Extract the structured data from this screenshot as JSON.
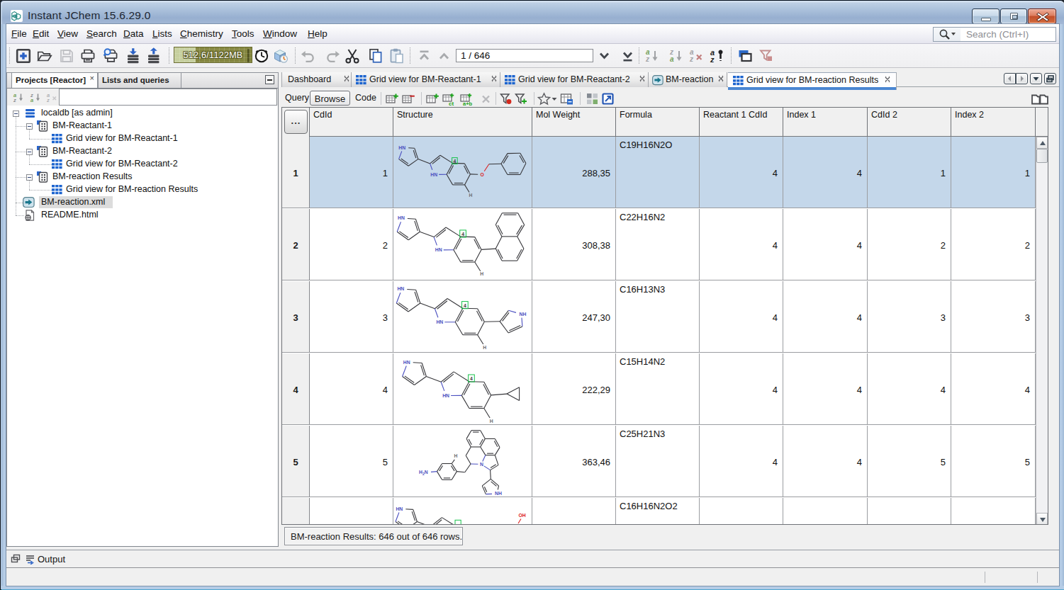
{
  "window": {
    "title": "Instant JChem 15.6.29.0",
    "controls": {
      "minimize": "minimize",
      "maximize": "maximize",
      "close": "close"
    }
  },
  "menu": {
    "items": [
      {
        "label": "File"
      },
      {
        "label": "Edit"
      },
      {
        "label": "View"
      },
      {
        "label": "Search"
      },
      {
        "label": "Data"
      },
      {
        "label": "Lists"
      },
      {
        "label": "Chemistry"
      },
      {
        "label": "Tools"
      },
      {
        "label": "Window"
      },
      {
        "label": "Help"
      }
    ]
  },
  "toolbar": {
    "memory": "512,6/1122MB",
    "record_position": "1 / 646",
    "icons": [
      "new-form-icon",
      "open-project-icon",
      "save-icon",
      "print-icon",
      "print-preview-icon",
      "import-icon",
      "export-icon",
      "garbage-collect-clock-icon",
      "scheduler-cube-icon",
      "undo-icon",
      "redo-icon",
      "cut-icon",
      "copy-icon",
      "paste-icon",
      "first-record-icon",
      "previous-record-icon",
      "next-record-icon",
      "last-record-icon",
      "sort-ascending-icon",
      "sort-descending-icon",
      "clear-sort-icon",
      "sort-options-icon",
      "windows-icon",
      "filter-icon"
    ]
  },
  "search": {
    "placeholder": "Search (Ctrl+I)"
  },
  "left_panel": {
    "tabs": [
      {
        "label": "Projects [Reactor]",
        "active": true,
        "closable": true
      },
      {
        "label": "Lists and queries",
        "active": false
      }
    ],
    "filter_value": "",
    "tree": [
      {
        "label": "localdb [as admin]",
        "icon": "database-icon",
        "level": 0,
        "expanded": true
      },
      {
        "label": "BM-Reactant-1",
        "icon": "data-tree-icon",
        "level": 1,
        "expanded": true
      },
      {
        "label": "Grid view for BM-Reactant-1",
        "icon": "grid-view-icon",
        "level": 2
      },
      {
        "label": "BM-Reactant-2",
        "icon": "data-tree-icon",
        "level": 1,
        "expanded": true
      },
      {
        "label": "Grid view for BM-Reactant-2",
        "icon": "grid-view-icon",
        "level": 2
      },
      {
        "label": "BM-reaction Results",
        "icon": "data-tree-icon",
        "level": 1,
        "expanded": true
      },
      {
        "label": "Grid view for BM-reaction Results",
        "icon": "grid-view-icon",
        "level": 2
      },
      {
        "label": "BM-reaction.xml",
        "icon": "reaction-file-icon",
        "level": 0,
        "selected": true
      },
      {
        "label": "README.html",
        "icon": "html-file-icon",
        "level": 0
      }
    ]
  },
  "main_tabs": [
    {
      "label": "Dashboard",
      "icon": null,
      "active": false
    },
    {
      "label": "Grid view for BM-Reactant-1",
      "icon": "grid-view-icon",
      "active": false
    },
    {
      "label": "Grid view for BM-Reactant-2",
      "icon": "grid-view-icon",
      "active": false
    },
    {
      "label": "BM-reaction",
      "icon": "reaction-file-icon",
      "active": false
    },
    {
      "label": "Grid view for BM-reaction Results",
      "icon": "grid-view-icon",
      "active": true
    }
  ],
  "view_toolbar": {
    "modes": [
      {
        "label": "Query"
      },
      {
        "label": "Browse",
        "active": true
      },
      {
        "label": "Code"
      }
    ],
    "icons": [
      "add-row-icon",
      "delete-row-icon",
      "add-field-icon",
      "add-chemical-terms-field-icon",
      "add-calculated-field-icon",
      "remove-field-icon",
      "filter-red-icon",
      "add-filter-icon",
      "favorites-star-icon",
      "favorites-dropdown-icon",
      "grid-settings-icon",
      "layout-grid-icon",
      "open-in-new-icon",
      "book-icon"
    ]
  },
  "grid": {
    "corner_button": "...",
    "columns": [
      "CdId",
      "Structure",
      "Mol Weight",
      "Formula",
      "Reactant 1 CdId",
      "Index 1",
      "CdId 2",
      "Index 2"
    ],
    "rows": [
      {
        "row_num": "1",
        "cdid": "1",
        "mol_weight": "288,35",
        "formula": "C19H16N2O",
        "reactant1_cdid": "4",
        "index1": "4",
        "cdid2": "1",
        "index2": "1",
        "selected": true,
        "structure": "5-(benzyloxy)-2-(1H-pyrrol-3-yl)-1H-indole"
      },
      {
        "row_num": "2",
        "cdid": "2",
        "mol_weight": "308,38",
        "formula": "C22H16N2",
        "reactant1_cdid": "4",
        "index1": "4",
        "cdid2": "2",
        "index2": "2",
        "selected": false,
        "structure": "5-(naphthalen-1-yl)-2-(1H-pyrrol-3-yl)-1H-indole"
      },
      {
        "row_num": "3",
        "cdid": "3",
        "mol_weight": "247,30",
        "formula": "C16H13N3",
        "reactant1_cdid": "4",
        "index1": "4",
        "cdid2": "3",
        "index2": "3",
        "selected": false,
        "structure": "5-(1H-pyrrol-3-yl)-2-(1H-pyrrol-3-yl)-1H-indole"
      },
      {
        "row_num": "4",
        "cdid": "4",
        "mol_weight": "222,29",
        "formula": "C15H14N2",
        "reactant1_cdid": "4",
        "index1": "4",
        "cdid2": "4",
        "index2": "4",
        "selected": false,
        "structure": "5-cyclopropyl-2-(1H-pyrrol-3-yl)-1H-indole"
      },
      {
        "row_num": "5",
        "cdid": "5",
        "mol_weight": "363,46",
        "formula": "C25H21N3",
        "reactant1_cdid": "4",
        "index1": "4",
        "cdid2": "5",
        "index2": "5",
        "selected": false,
        "structure": "4-aminobenzyl pyrroloquinoline pyrrole"
      },
      {
        "row_num": "",
        "cdid": "",
        "mol_weight": "",
        "formula": "C16H16N2O2",
        "reactant1_cdid": "",
        "index1": "",
        "cdid2": "",
        "index2": "",
        "selected": false,
        "structure": "partially visible row"
      }
    ]
  },
  "status_box": {
    "text": "BM-reaction Results: 646 out of 646 rows."
  },
  "output": {
    "label": "Output"
  },
  "colors": {
    "selection_blue": "#c4d7ea",
    "active_tab_underline": "#4a86d2",
    "grid_view_icon_blue": "#1c64cf",
    "title_gradient_top": "#c8d8eb",
    "memory_bar_olive": "#84863f",
    "close_button_red": "#c24f2a",
    "structure_nitrogen": "#4b50c0",
    "structure_oxygen": "#dd2020",
    "structure_map_green": "#17c24a"
  }
}
